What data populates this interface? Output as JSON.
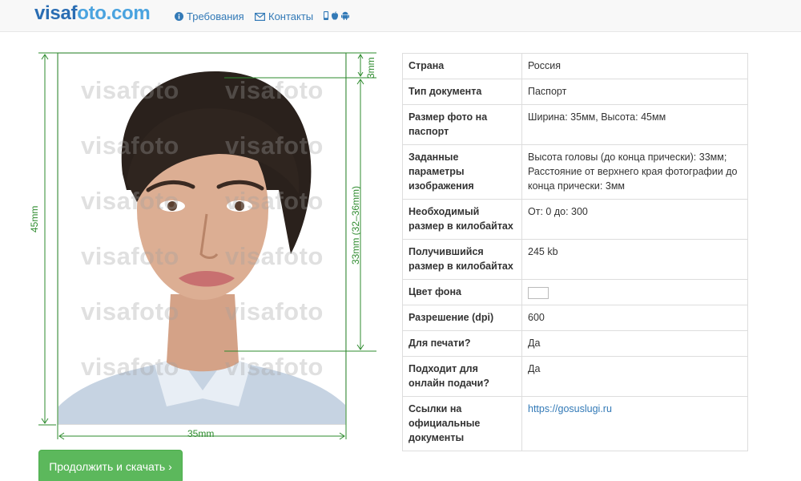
{
  "header": {
    "logo_part1": "visaf",
    "logo_part2": "oto.com",
    "nav": [
      {
        "label": "Требования",
        "icon": "info-circle-icon"
      },
      {
        "label": "Контакты",
        "icon": "envelope-icon"
      }
    ],
    "apps": {
      "icons": [
        "mobile-icon",
        "apple-icon",
        "android-icon"
      ]
    }
  },
  "photo": {
    "watermark": "visafoto",
    "dimensions": {
      "width": "35mm",
      "height": "45mm",
      "head": "33mm (32–36mm)",
      "top_margin": "3mm"
    },
    "guide_color": "#2e8b2e"
  },
  "details": {
    "rows": [
      {
        "key": "Страна",
        "value": "Россия"
      },
      {
        "key": "Тип документа",
        "value": "Паспорт"
      },
      {
        "key": "Размер фото на паспорт",
        "value": "Ширина: 35мм, Высота: 45мм"
      },
      {
        "key": "Заданные параметры изображения",
        "value": "Высота головы (до конца прически): 33мм; Расстояние от верхнего края фотографии до конца прически: 3мм"
      },
      {
        "key": "Необходимый размер в килобайтах",
        "value": "От: 0 до: 300"
      },
      {
        "key": "Получившийся размер в килобайтах",
        "value": "245 kb"
      },
      {
        "key": "Цвет фона",
        "value": "",
        "swatch_color": "#ffffff"
      },
      {
        "key": "Разрешение (dpi)",
        "value": "600"
      },
      {
        "key": "Для печати?",
        "value": "Да"
      },
      {
        "key": "Подходит для онлайн подачи?",
        "value": "Да"
      },
      {
        "key": "Ссылки на официальные документы",
        "value": "https://gosuslugi.ru"
      }
    ]
  },
  "cta": {
    "label": "Продолжить и скачать ›"
  },
  "colors": {
    "accent": "#337ab7",
    "button": "#5cb85c",
    "guides": "#2e8b2e",
    "logo_dark": "#2a6db3",
    "logo_light": "#4aa3df"
  }
}
